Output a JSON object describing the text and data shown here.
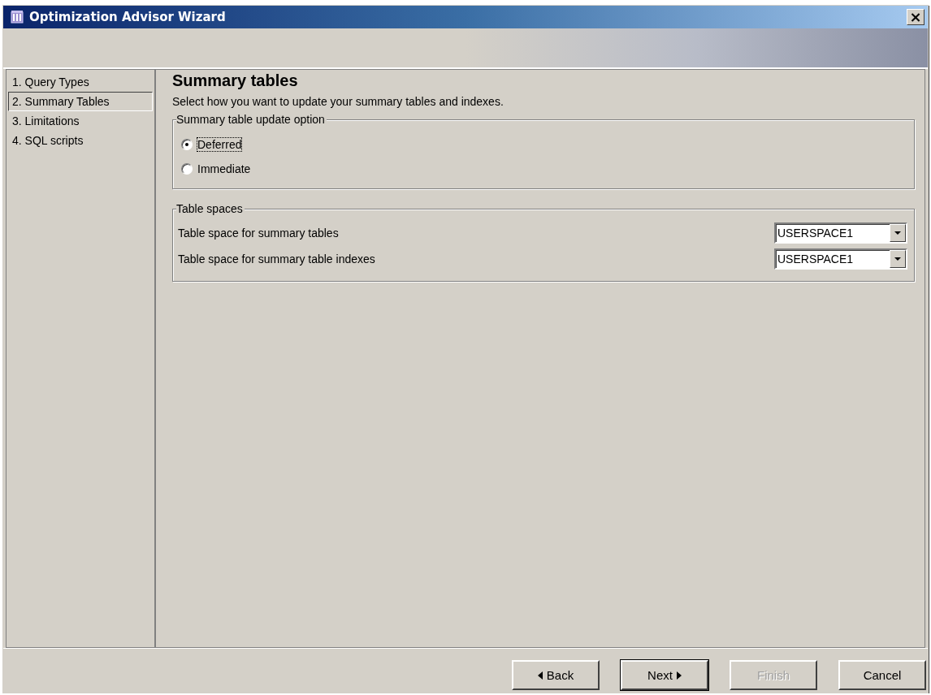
{
  "window": {
    "title": "Optimization Advisor Wizard",
    "close": "×"
  },
  "steps": [
    {
      "label": "1. Query Types",
      "selected": false
    },
    {
      "label": "2. Summary Tables",
      "selected": true
    },
    {
      "label": "3. Limitations",
      "selected": false
    },
    {
      "label": "4. SQL scripts",
      "selected": false
    }
  ],
  "page": {
    "title": "Summary tables",
    "description": "Select how you want to update your summary tables and indexes."
  },
  "update_group": {
    "title": "Summary table update option",
    "options": [
      {
        "label": "Deferred",
        "selected": true
      },
      {
        "label": "Immediate",
        "selected": false
      }
    ]
  },
  "tablespace_group": {
    "title": "Table spaces",
    "rows": [
      {
        "label": "Table space for summary tables",
        "value": "USERSPACE1"
      },
      {
        "label": "Table space for summary table indexes",
        "value": "USERSPACE1"
      }
    ]
  },
  "buttons": [
    {
      "label": "Back",
      "kind": "back",
      "disabled": false,
      "default": false
    },
    {
      "label": "Next",
      "kind": "next",
      "disabled": false,
      "default": true
    },
    {
      "label": "Finish",
      "kind": "plain",
      "disabled": true,
      "default": false
    },
    {
      "label": "Cancel",
      "kind": "plain",
      "disabled": false,
      "default": false
    }
  ]
}
